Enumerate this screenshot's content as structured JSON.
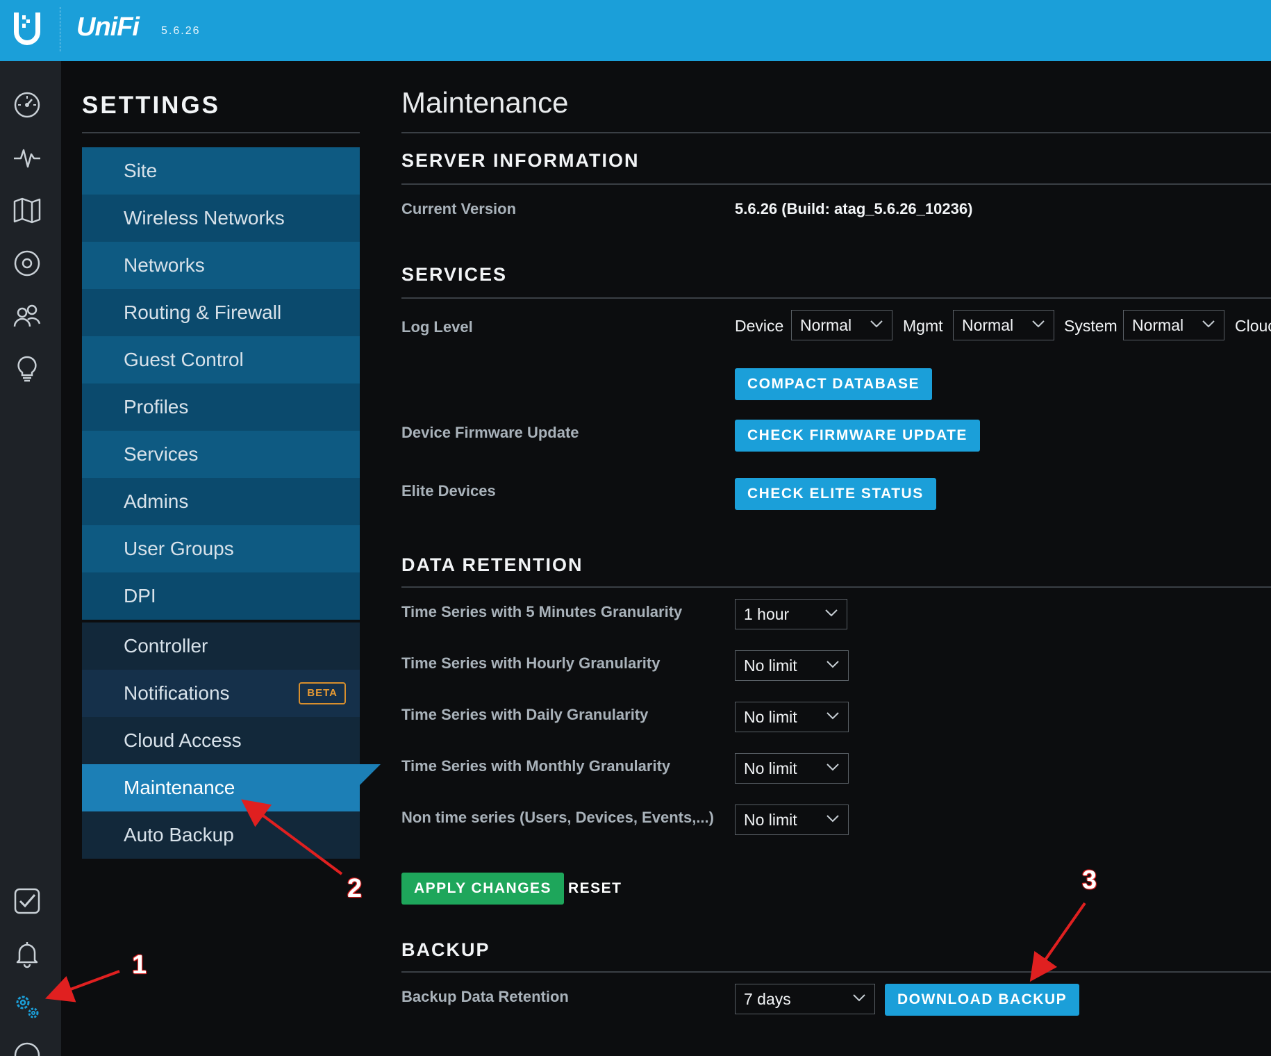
{
  "header": {
    "brand": "UniFi",
    "version": "5.6.26"
  },
  "rail": {
    "icons": [
      "dashboard-icon",
      "statistics-icon",
      "map-icon",
      "devices-icon",
      "clients-icon",
      "insights-icon",
      "events-icon",
      "alerts-icon",
      "settings-icon"
    ]
  },
  "nav": {
    "title": "SETTINGS",
    "group1": [
      "Site",
      "Wireless Networks",
      "Networks",
      "Routing & Firewall",
      "Guest Control",
      "Profiles",
      "Services",
      "Admins",
      "User Groups",
      "DPI"
    ],
    "group2": [
      "Controller",
      "Notifications",
      "Cloud Access",
      "Maintenance",
      "Auto Backup"
    ],
    "beta_badge": "BETA",
    "active": "Maintenance"
  },
  "main": {
    "title": "Maintenance",
    "server_info": {
      "heading": "SERVER INFORMATION",
      "current_version_label": "Current Version",
      "current_version_value": "5.6.26 (Build: atag_5.6.26_10236)"
    },
    "services": {
      "heading": "SERVICES",
      "log_level_label": "Log Level",
      "device_label": "Device",
      "device_value": "Normal",
      "mgmt_label": "Mgmt",
      "mgmt_value": "Normal",
      "system_label": "System",
      "system_value": "Normal",
      "cloud_label": "Clouc",
      "compact_db_button": "COMPACT DATABASE",
      "firmware_label": "Device Firmware Update",
      "firmware_button": "CHECK FIRMWARE UPDATE",
      "elite_label": "Elite Devices",
      "elite_button": "CHECK ELITE STATUS"
    },
    "data_retention": {
      "heading": "DATA RETENTION",
      "rows": [
        {
          "label": "Time Series with 5 Minutes Granularity",
          "value": "1 hour"
        },
        {
          "label": "Time Series with Hourly Granularity",
          "value": "No limit"
        },
        {
          "label": "Time Series with Daily Granularity",
          "value": "No limit"
        },
        {
          "label": "Time Series with Monthly Granularity",
          "value": "No limit"
        },
        {
          "label": "Non time series (Users, Devices, Events,...)",
          "value": "No limit"
        }
      ],
      "apply_button": "APPLY CHANGES",
      "reset_button": "RESET"
    },
    "backup": {
      "heading": "BACKUP",
      "retention_label": "Backup Data Retention",
      "retention_value": "7 days",
      "download_button": "DOWNLOAD BACKUP"
    }
  },
  "annotations": {
    "step1": "1",
    "step2": "2",
    "step3": "3",
    "arrow_color": "#e02020"
  },
  "colors": {
    "accent": "#1b9fd9",
    "apply": "#1ea65b",
    "active_nav": "#1c7fb6",
    "beta": "#e79a33"
  }
}
